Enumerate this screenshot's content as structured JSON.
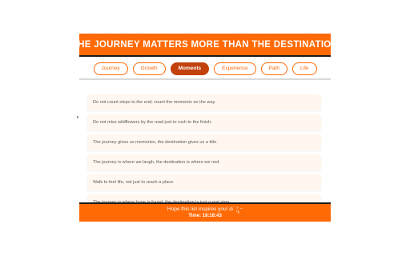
{
  "header": {
    "title": "THE JOURNEY MATTERS MORE THAN THE DESTINATION"
  },
  "tabs": [
    {
      "label": "Journey",
      "active": false
    },
    {
      "label": "Growth",
      "active": false
    },
    {
      "label": "Moments",
      "active": true
    },
    {
      "label": "Experience",
      "active": false
    },
    {
      "label": "Path",
      "active": false
    },
    {
      "label": "Life",
      "active": false
    }
  ],
  "quotes": [
    "Do not count steps to the end; count the moments on the way.",
    "Do not miss wildflowers by the road just to rush to the finish.",
    "The journey gives us memories, the destination gives us a title.",
    "The journey is where we laugh, the destination is where we nod.",
    "Walk to feel life, not just to reach a place.",
    "The journey is where hope is found, the destination is just a rest stop."
  ],
  "footer": {
    "message": "Hope this list inspires you! ద್ಷ್ದಿ−",
    "time": "Time: 18:18:43"
  },
  "colors": {
    "accent": "#ff6a06",
    "active_tab": "#c2410c",
    "item_bg": "#fff7ef",
    "text": "#5a5a5a"
  }
}
